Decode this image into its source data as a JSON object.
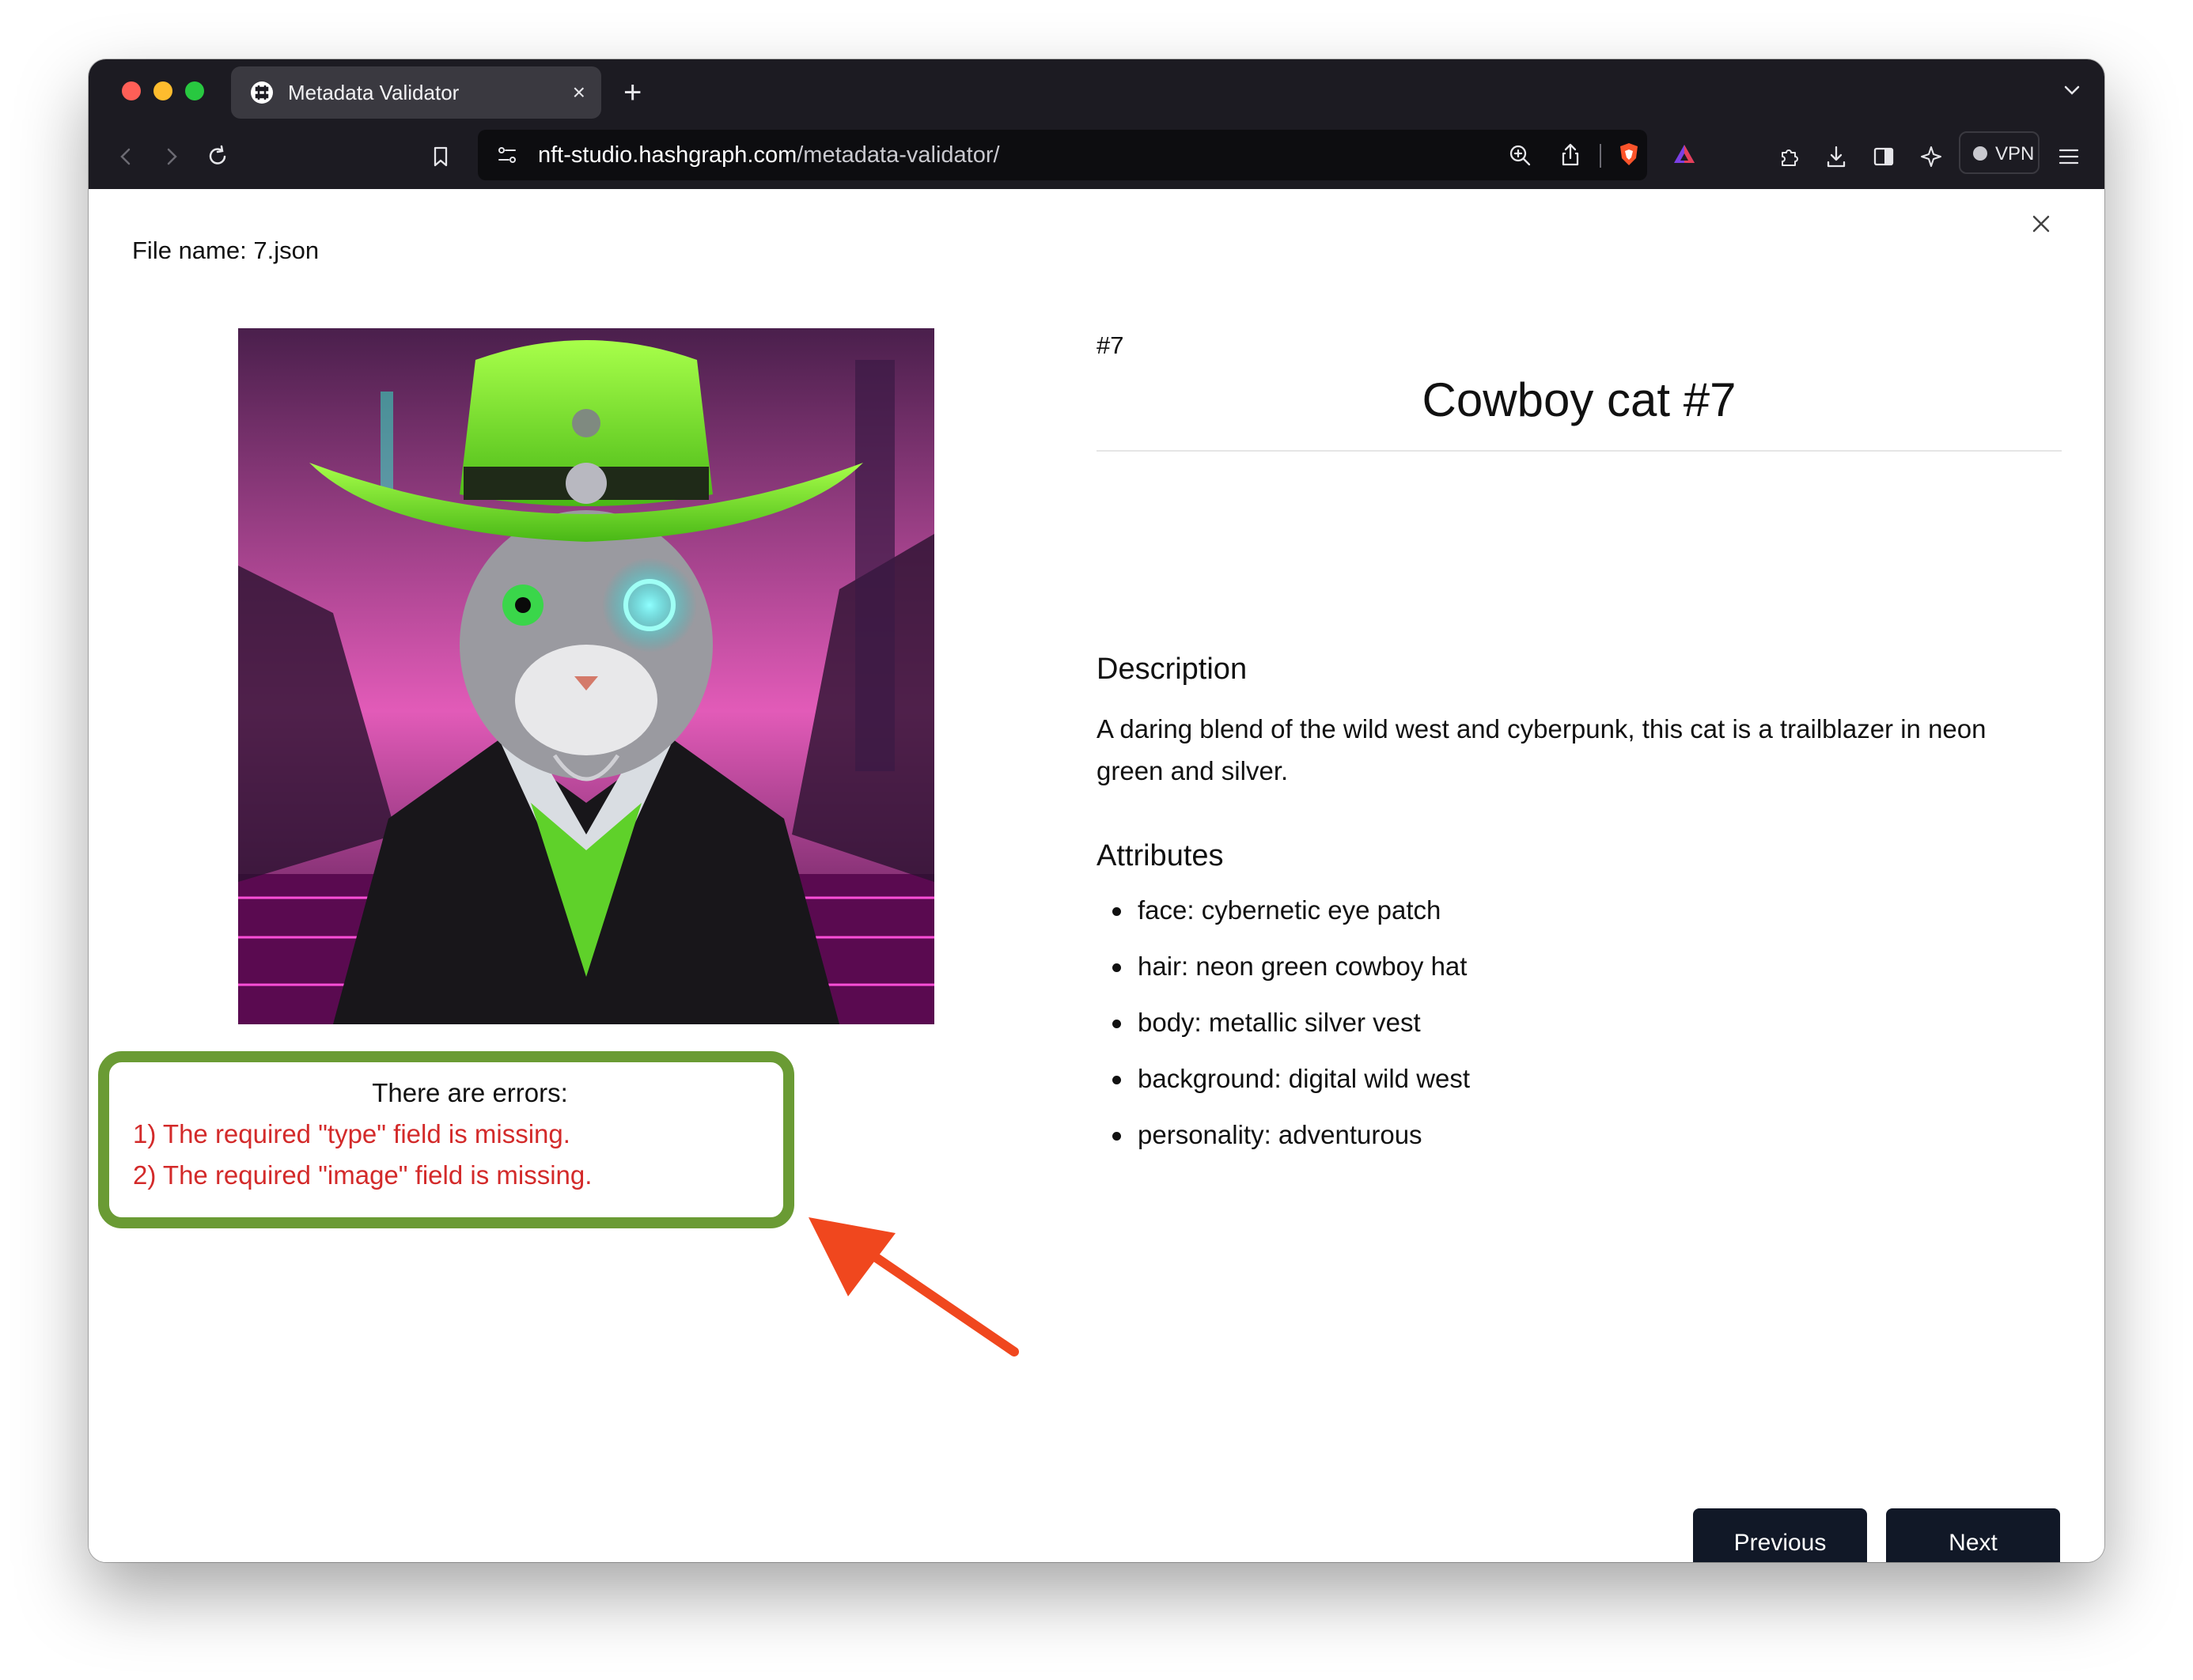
{
  "browser": {
    "tab_title": "Metadata Validator",
    "tab_close": "×",
    "new_tab": "+",
    "url_host": "nft-studio.hashgraph.com",
    "url_path": "/metadata-validator/",
    "vpn_label": "VPN"
  },
  "modal": {
    "file_name_label": "File name:",
    "file_name": "7.json"
  },
  "errors": {
    "title": "There are errors:",
    "items": [
      "1) The required \"type\" field is missing.",
      "2) The required \"image\" field is missing."
    ]
  },
  "nft": {
    "serial": "#7",
    "name": "Cowboy cat #7",
    "description_heading": "Description",
    "description": "A daring blend of the wild west and cyberpunk, this cat is a trailblazer in neon green and silver.",
    "attributes_heading": "Attributes",
    "attributes": [
      "face: cybernetic eye patch",
      "hair: neon green cowboy hat",
      "body: metallic silver vest",
      "background: digital wild west",
      "personality: adventurous"
    ]
  },
  "nav": {
    "previous": "Previous",
    "next": "Next"
  },
  "colors": {
    "error_border": "#6a9b34",
    "error_text": "#d32a2a",
    "button_bg": "#111827",
    "arrow": "#f0471e",
    "browser_chrome": "#1c1b22"
  }
}
